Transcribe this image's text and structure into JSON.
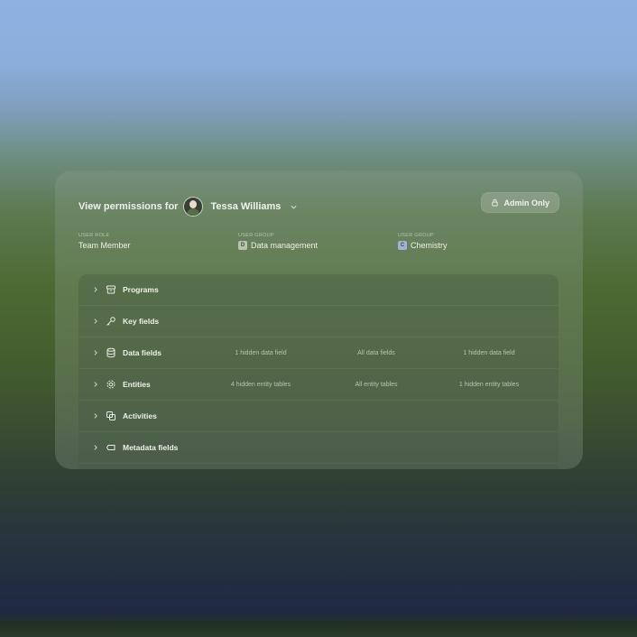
{
  "header": {
    "title": "View permissions for",
    "user_name": "Tessa Williams",
    "admin_button": "Admin Only"
  },
  "meta": [
    {
      "label": "USER ROLE",
      "value": "Team Member",
      "chip": ""
    },
    {
      "label": "USER GROUP",
      "value": "Data management",
      "chip": "D",
      "chip_color": "#b8c3b0"
    },
    {
      "label": "USER GROUP",
      "value": "Chemistry",
      "chip": "C",
      "chip_color": "#9fb3d8"
    }
  ],
  "rows": [
    {
      "label": "Programs",
      "icon": "box-icon",
      "c1": "",
      "c2": "",
      "c3": ""
    },
    {
      "label": "Key fields",
      "icon": "key-icon",
      "c1": "",
      "c2": "",
      "c3": ""
    },
    {
      "label": "Data fields",
      "icon": "database-icon",
      "c1": "1 hidden data field",
      "c2": "All data fields",
      "c3": "1 hidden data field"
    },
    {
      "label": "Entities",
      "icon": "gear-icon",
      "c1": "4 hidden entity tables",
      "c2": "All entity tables",
      "c3": "1 hidden entity tables"
    },
    {
      "label": "Activities",
      "icon": "copy-icon",
      "c1": "",
      "c2": "",
      "c3": ""
    },
    {
      "label": "Metadata fields",
      "icon": "tag-icon",
      "c1": "",
      "c2": "",
      "c3": ""
    }
  ]
}
